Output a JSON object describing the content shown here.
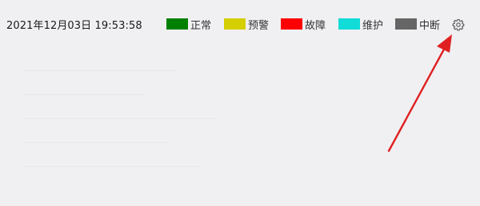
{
  "header": {
    "datetime": "2021年12月03日 19:53:58"
  },
  "legend": [
    {
      "label": "正常",
      "color": "#008000"
    },
    {
      "label": "预警",
      "color": "#d6cf00"
    },
    {
      "label": "故障",
      "color": "#ff0000"
    },
    {
      "label": "维护",
      "color": "#12dcd8"
    },
    {
      "label": "中断",
      "color": "#666666"
    }
  ],
  "settings": {
    "icon": "gear-icon"
  },
  "annotation": {
    "arrow_color": "#e02020"
  }
}
